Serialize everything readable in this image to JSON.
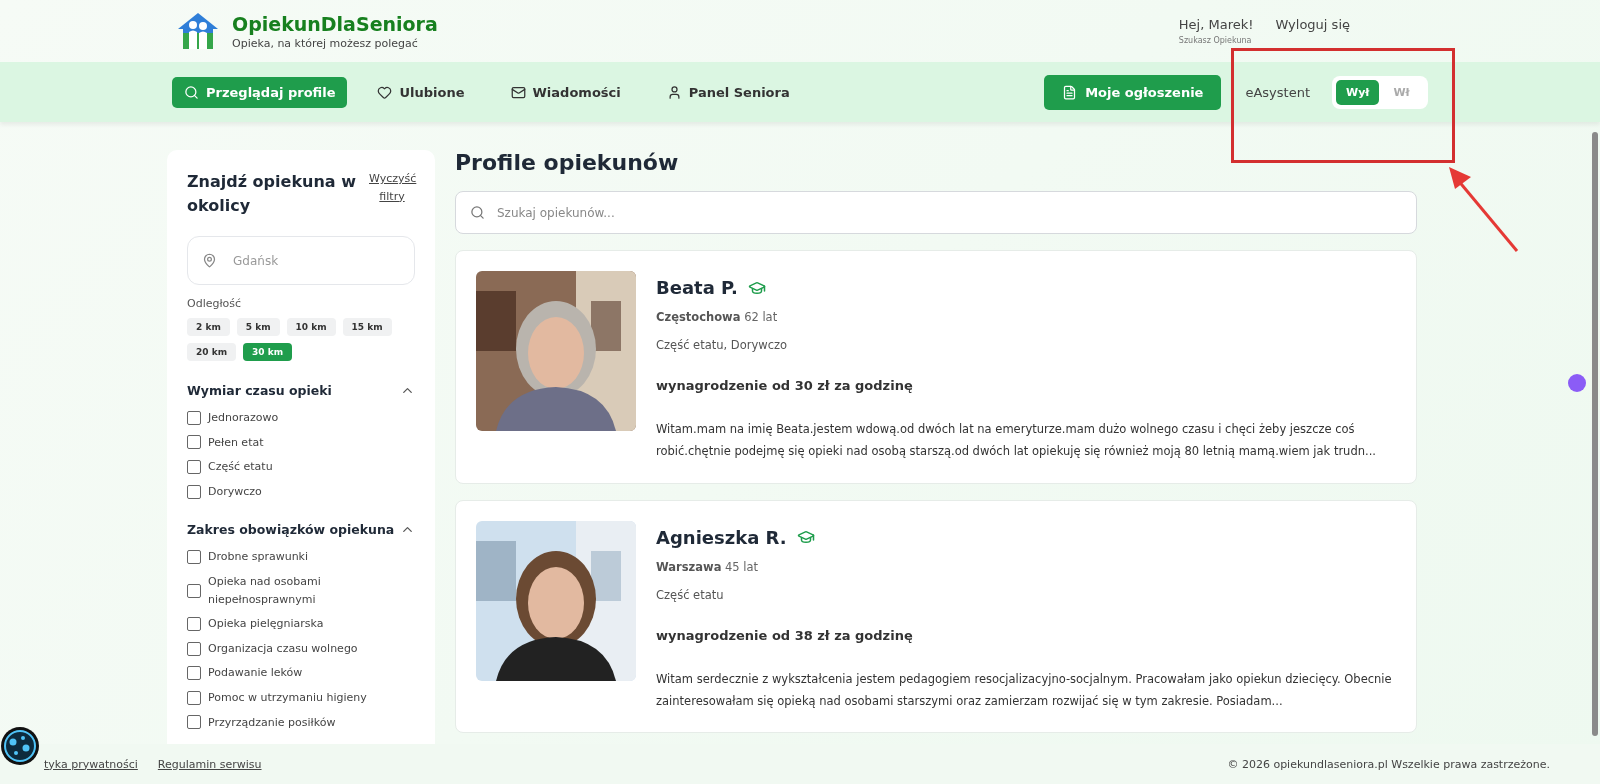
{
  "header": {
    "logo_title": "OpiekunDlaSeniora",
    "tagline": "Opieka, na której możesz polegać",
    "greeting": "Hej, Marek!",
    "logout": "Wyloguj się",
    "role": "Szukasz Opiekuna"
  },
  "nav": {
    "items": [
      {
        "label": "Przeglądaj profile",
        "selected": true
      },
      {
        "label": "Ulubione",
        "selected": false
      },
      {
        "label": "Wiadomości",
        "selected": false
      },
      {
        "label": "Panel Seniora",
        "selected": false
      }
    ],
    "cta": "Moje ogłoszenie",
    "assistant": {
      "label": "eAsystent",
      "options": [
        {
          "label": "Wył",
          "selected": true
        },
        {
          "label": "Wł",
          "selected": false
        }
      ]
    }
  },
  "filters": {
    "title": "Znajdź opiekuna w okolicy",
    "clear": "Wyczyść filtry",
    "location_placeholder": "Gdańsk",
    "distance_label": "Odległość",
    "distances": [
      {
        "label": "2 km",
        "selected": false
      },
      {
        "label": "5 km",
        "selected": false
      },
      {
        "label": "10 km",
        "selected": false
      },
      {
        "label": "15 km",
        "selected": false
      },
      {
        "label": "20 km",
        "selected": false
      },
      {
        "label": "30 km",
        "selected": true
      }
    ],
    "sections": [
      {
        "title": "Wymiar czasu opieki",
        "expanded": true,
        "options": [
          {
            "label": "Jednorazowo",
            "checked": false
          },
          {
            "label": "Pełen etat",
            "checked": false
          },
          {
            "label": "Część etatu",
            "checked": false
          },
          {
            "label": "Dorywczo",
            "checked": false
          }
        ]
      },
      {
        "title": "Zakres obowiązków opiekuna",
        "expanded": true,
        "options": [
          {
            "label": "Drobne sprawunki",
            "checked": false
          },
          {
            "label": "Opieka nad osobami niepełnosprawnymi",
            "checked": false
          },
          {
            "label": "Opieka pielęgniarska",
            "checked": false
          },
          {
            "label": "Organizacja czasu wolnego",
            "checked": false
          },
          {
            "label": "Podawanie leków",
            "checked": false
          },
          {
            "label": "Pomoc w utrzymaniu higieny",
            "checked": false
          },
          {
            "label": "Przyrządzanie posiłków",
            "checked": false
          }
        ]
      }
    ]
  },
  "main": {
    "title": "Profile opiekunów",
    "search_placeholder": "Szukaj opiekunów...",
    "profiles": [
      {
        "name": "Beata P.",
        "city": "Częstochowa",
        "age": "62 lat",
        "schedule": "Część etatu, Dorywczo",
        "salary": "wynagrodzenie od 30 zł za godzinę",
        "description": "Witam.mam na imię Beata.jestem wdową.od dwóch lat na emeryturze.mam dużo wolnego czasu i chęci żeby jeszcze coś robić.chętnie podejmę się opieki nad osobą starszą.od dwóch lat opiekuję się również moją 80 letnią mamą.wiem jak trudn..."
      },
      {
        "name": "Agnieszka R.",
        "city": "Warszawa",
        "age": "45 lat",
        "schedule": "Część etatu",
        "salary": "wynagrodzenie od 38 zł za godzinę",
        "description": "Witam serdecznie z wykształcenia jestem pedagogiem resocjalizacyjno-socjalnym. Pracowałam jako opiekun dziecięcy. Obecnie zainteresowałam się opieką nad osobami starszymi oraz zamierzam rozwijać się w tym zakresie. Posiadam..."
      }
    ]
  },
  "footer": {
    "links": [
      "tyka prywatności",
      "Regulamin serwisu"
    ],
    "copyright": "© 2026 opiekundlaseniora.pl Wszelkie prawa zastrzeżone."
  }
}
